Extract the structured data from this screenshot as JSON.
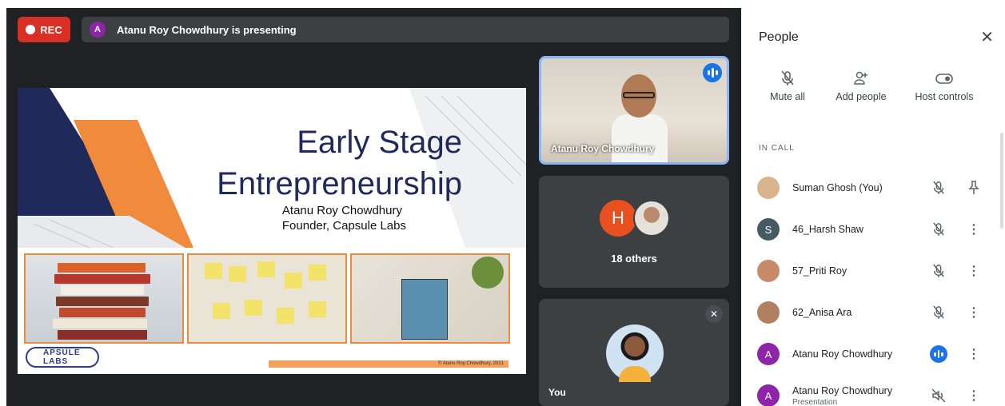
{
  "meet": {
    "rec_label": "REC",
    "presenting": {
      "avatar_letter": "A",
      "text": "Atanu Roy Chowdhury is presenting"
    }
  },
  "slide": {
    "title_line1": "Early Stage",
    "title_line2": "Entrepreneurship",
    "author": "Atanu Roy Chowdhury",
    "role": "Founder, Capsule Labs",
    "logo_text": "APSULE LABS",
    "copyright": "© Atanu Roy Chowdhury, 2021"
  },
  "tiles": {
    "speaker_name": "Atanu Roy Chowdhury",
    "others_letter": "H",
    "others_label": "18 others",
    "you_label": "You"
  },
  "panel": {
    "title": "People",
    "close_glyph": "✕",
    "actions": [
      {
        "label": "Mute all",
        "icon": "mic-off-icon"
      },
      {
        "label": "Add people",
        "icon": "person-add-icon"
      },
      {
        "label": "Host controls",
        "icon": "toggle-icon"
      }
    ],
    "section_label": "IN CALL",
    "participants": [
      {
        "name": "Suman Ghosh (You)",
        "sub": "",
        "letter": "",
        "color": "#d9b38c",
        "status": "mic-off",
        "action": "pin"
      },
      {
        "name": "46_Harsh Shaw",
        "sub": "",
        "letter": "S",
        "color": "#455a64",
        "status": "mic-off",
        "action": "more"
      },
      {
        "name": "57_Priti Roy",
        "sub": "",
        "letter": "",
        "color": "#c98a6a",
        "status": "mic-off",
        "action": "more"
      },
      {
        "name": "62_Anisa Ara",
        "sub": "",
        "letter": "",
        "color": "#b08060",
        "status": "mic-off",
        "action": "more"
      },
      {
        "name": "Atanu Roy Chowdhury",
        "sub": "",
        "letter": "A",
        "color": "#8e24aa",
        "status": "speaking",
        "action": "more"
      },
      {
        "name": "Atanu Roy Chowdhury",
        "sub": "Presentation",
        "letter": "A",
        "color": "#8e24aa",
        "status": "presentation-muted",
        "action": "more"
      }
    ]
  }
}
